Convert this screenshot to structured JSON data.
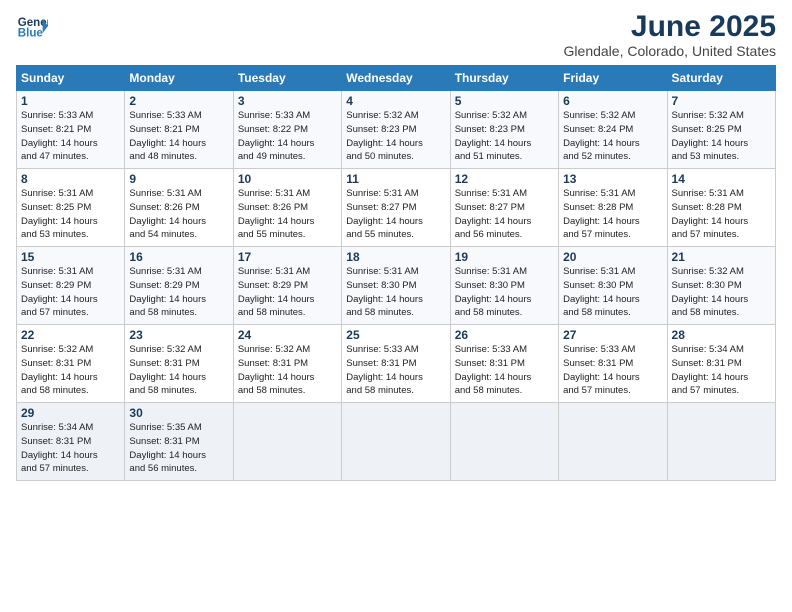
{
  "header": {
    "logo_line1": "General",
    "logo_line2": "Blue",
    "title": "June 2025",
    "subtitle": "Glendale, Colorado, United States"
  },
  "columns": [
    "Sunday",
    "Monday",
    "Tuesday",
    "Wednesday",
    "Thursday",
    "Friday",
    "Saturday"
  ],
  "weeks": [
    [
      {
        "day": "1",
        "lines": [
          "Sunrise: 5:33 AM",
          "Sunset: 8:21 PM",
          "Daylight: 14 hours",
          "and 47 minutes."
        ]
      },
      {
        "day": "2",
        "lines": [
          "Sunrise: 5:33 AM",
          "Sunset: 8:21 PM",
          "Daylight: 14 hours",
          "and 48 minutes."
        ]
      },
      {
        "day": "3",
        "lines": [
          "Sunrise: 5:33 AM",
          "Sunset: 8:22 PM",
          "Daylight: 14 hours",
          "and 49 minutes."
        ]
      },
      {
        "day": "4",
        "lines": [
          "Sunrise: 5:32 AM",
          "Sunset: 8:23 PM",
          "Daylight: 14 hours",
          "and 50 minutes."
        ]
      },
      {
        "day": "5",
        "lines": [
          "Sunrise: 5:32 AM",
          "Sunset: 8:23 PM",
          "Daylight: 14 hours",
          "and 51 minutes."
        ]
      },
      {
        "day": "6",
        "lines": [
          "Sunrise: 5:32 AM",
          "Sunset: 8:24 PM",
          "Daylight: 14 hours",
          "and 52 minutes."
        ]
      },
      {
        "day": "7",
        "lines": [
          "Sunrise: 5:32 AM",
          "Sunset: 8:25 PM",
          "Daylight: 14 hours",
          "and 53 minutes."
        ]
      }
    ],
    [
      {
        "day": "8",
        "lines": [
          "Sunrise: 5:31 AM",
          "Sunset: 8:25 PM",
          "Daylight: 14 hours",
          "and 53 minutes."
        ]
      },
      {
        "day": "9",
        "lines": [
          "Sunrise: 5:31 AM",
          "Sunset: 8:26 PM",
          "Daylight: 14 hours",
          "and 54 minutes."
        ]
      },
      {
        "day": "10",
        "lines": [
          "Sunrise: 5:31 AM",
          "Sunset: 8:26 PM",
          "Daylight: 14 hours",
          "and 55 minutes."
        ]
      },
      {
        "day": "11",
        "lines": [
          "Sunrise: 5:31 AM",
          "Sunset: 8:27 PM",
          "Daylight: 14 hours",
          "and 55 minutes."
        ]
      },
      {
        "day": "12",
        "lines": [
          "Sunrise: 5:31 AM",
          "Sunset: 8:27 PM",
          "Daylight: 14 hours",
          "and 56 minutes."
        ]
      },
      {
        "day": "13",
        "lines": [
          "Sunrise: 5:31 AM",
          "Sunset: 8:28 PM",
          "Daylight: 14 hours",
          "and 57 minutes."
        ]
      },
      {
        "day": "14",
        "lines": [
          "Sunrise: 5:31 AM",
          "Sunset: 8:28 PM",
          "Daylight: 14 hours",
          "and 57 minutes."
        ]
      }
    ],
    [
      {
        "day": "15",
        "lines": [
          "Sunrise: 5:31 AM",
          "Sunset: 8:29 PM",
          "Daylight: 14 hours",
          "and 57 minutes."
        ]
      },
      {
        "day": "16",
        "lines": [
          "Sunrise: 5:31 AM",
          "Sunset: 8:29 PM",
          "Daylight: 14 hours",
          "and 58 minutes."
        ]
      },
      {
        "day": "17",
        "lines": [
          "Sunrise: 5:31 AM",
          "Sunset: 8:29 PM",
          "Daylight: 14 hours",
          "and 58 minutes."
        ]
      },
      {
        "day": "18",
        "lines": [
          "Sunrise: 5:31 AM",
          "Sunset: 8:30 PM",
          "Daylight: 14 hours",
          "and 58 minutes."
        ]
      },
      {
        "day": "19",
        "lines": [
          "Sunrise: 5:31 AM",
          "Sunset: 8:30 PM",
          "Daylight: 14 hours",
          "and 58 minutes."
        ]
      },
      {
        "day": "20",
        "lines": [
          "Sunrise: 5:31 AM",
          "Sunset: 8:30 PM",
          "Daylight: 14 hours",
          "and 58 minutes."
        ]
      },
      {
        "day": "21",
        "lines": [
          "Sunrise: 5:32 AM",
          "Sunset: 8:30 PM",
          "Daylight: 14 hours",
          "and 58 minutes."
        ]
      }
    ],
    [
      {
        "day": "22",
        "lines": [
          "Sunrise: 5:32 AM",
          "Sunset: 8:31 PM",
          "Daylight: 14 hours",
          "and 58 minutes."
        ]
      },
      {
        "day": "23",
        "lines": [
          "Sunrise: 5:32 AM",
          "Sunset: 8:31 PM",
          "Daylight: 14 hours",
          "and 58 minutes."
        ]
      },
      {
        "day": "24",
        "lines": [
          "Sunrise: 5:32 AM",
          "Sunset: 8:31 PM",
          "Daylight: 14 hours",
          "and 58 minutes."
        ]
      },
      {
        "day": "25",
        "lines": [
          "Sunrise: 5:33 AM",
          "Sunset: 8:31 PM",
          "Daylight: 14 hours",
          "and 58 minutes."
        ]
      },
      {
        "day": "26",
        "lines": [
          "Sunrise: 5:33 AM",
          "Sunset: 8:31 PM",
          "Daylight: 14 hours",
          "and 58 minutes."
        ]
      },
      {
        "day": "27",
        "lines": [
          "Sunrise: 5:33 AM",
          "Sunset: 8:31 PM",
          "Daylight: 14 hours",
          "and 57 minutes."
        ]
      },
      {
        "day": "28",
        "lines": [
          "Sunrise: 5:34 AM",
          "Sunset: 8:31 PM",
          "Daylight: 14 hours",
          "and 57 minutes."
        ]
      }
    ],
    [
      {
        "day": "29",
        "lines": [
          "Sunrise: 5:34 AM",
          "Sunset: 8:31 PM",
          "Daylight: 14 hours",
          "and 57 minutes."
        ]
      },
      {
        "day": "30",
        "lines": [
          "Sunrise: 5:35 AM",
          "Sunset: 8:31 PM",
          "Daylight: 14 hours",
          "and 56 minutes."
        ]
      },
      {
        "day": "",
        "lines": []
      },
      {
        "day": "",
        "lines": []
      },
      {
        "day": "",
        "lines": []
      },
      {
        "day": "",
        "lines": []
      },
      {
        "day": "",
        "lines": []
      }
    ]
  ]
}
